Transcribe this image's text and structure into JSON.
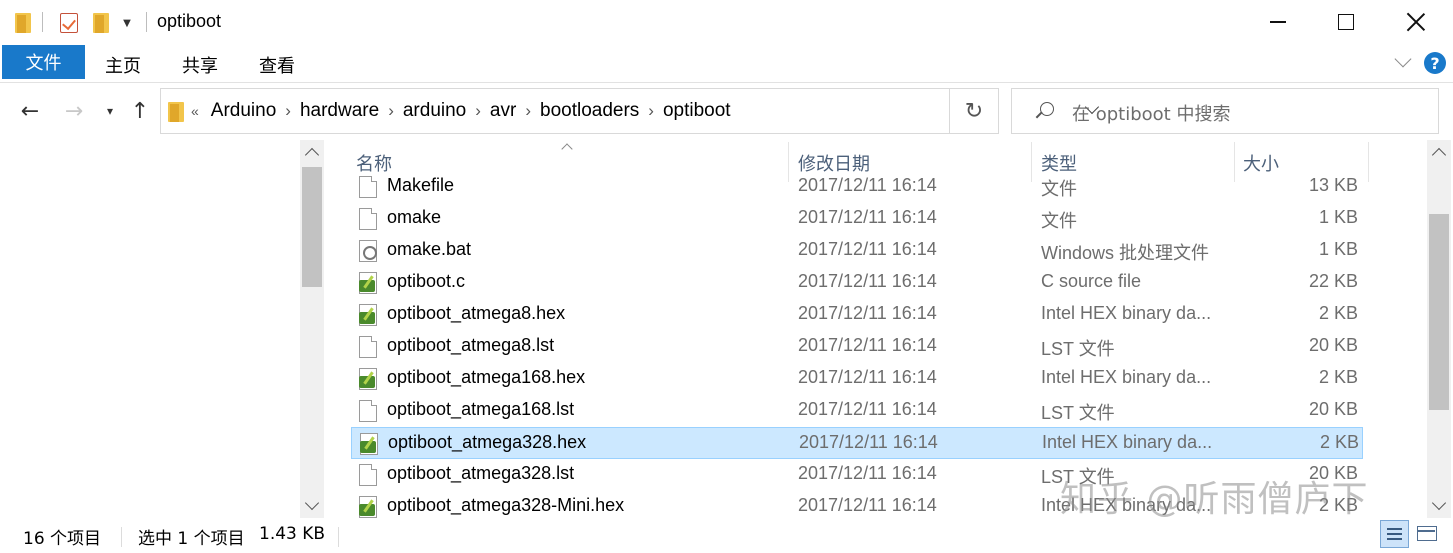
{
  "window": {
    "title": "optiboot"
  },
  "ribbon": {
    "tabs": [
      {
        "label": "文件"
      },
      {
        "label": "主页"
      },
      {
        "label": "共享"
      },
      {
        "label": "查看"
      }
    ],
    "help_label": "?"
  },
  "address": {
    "overflow": "«",
    "crumbs": [
      "Arduino",
      "hardware",
      "arduino",
      "avr",
      "bootloaders",
      "optiboot"
    ],
    "separator": "›"
  },
  "search": {
    "placeholder": "在 optiboot 中搜索"
  },
  "list": {
    "columns": {
      "name": "名称",
      "date": "修改日期",
      "type": "类型",
      "size": "大小"
    },
    "rows": [
      {
        "name": "Makefile",
        "date": "2017/12/11 16:14",
        "type": "文件",
        "size": "13 KB",
        "icon": "document-icon"
      },
      {
        "name": "omake",
        "date": "2017/12/11 16:14",
        "type": "文件",
        "size": "1 KB",
        "icon": "document-icon"
      },
      {
        "name": "omake.bat",
        "date": "2017/12/11 16:14",
        "type": "Windows 批处理文件",
        "size": "1 KB",
        "icon": "batch-file-icon"
      },
      {
        "name": "optiboot.c",
        "date": "2017/12/11 16:14",
        "type": "C source file",
        "size": "22 KB",
        "icon": "notepadpp-file-icon"
      },
      {
        "name": "optiboot_atmega8.hex",
        "date": "2017/12/11 16:14",
        "type": "Intel HEX binary da...",
        "size": "2 KB",
        "icon": "notepadpp-file-icon"
      },
      {
        "name": "optiboot_atmega8.lst",
        "date": "2017/12/11 16:14",
        "type": "LST 文件",
        "size": "20 KB",
        "icon": "document-icon"
      },
      {
        "name": "optiboot_atmega168.hex",
        "date": "2017/12/11 16:14",
        "type": "Intel HEX binary da...",
        "size": "2 KB",
        "icon": "notepadpp-file-icon"
      },
      {
        "name": "optiboot_atmega168.lst",
        "date": "2017/12/11 16:14",
        "type": "LST 文件",
        "size": "20 KB",
        "icon": "document-icon"
      },
      {
        "name": "optiboot_atmega328.hex",
        "date": "2017/12/11 16:14",
        "type": "Intel HEX binary da...",
        "size": "2 KB",
        "icon": "notepadpp-file-icon",
        "selected": true
      },
      {
        "name": "optiboot_atmega328.lst",
        "date": "2017/12/11 16:14",
        "type": "LST 文件",
        "size": "20 KB",
        "icon": "document-icon"
      },
      {
        "name": "optiboot_atmega328-Mini.hex",
        "date": "2017/12/11 16:14",
        "type": "Intel HEX binary da...",
        "size": "2 KB",
        "icon": "notepadpp-file-icon"
      }
    ]
  },
  "status": {
    "item_count": "16 个项目",
    "selection": "选中 1 个项目",
    "selection_size": "1.43 KB"
  },
  "watermark": "知乎 @听雨僧庐下",
  "colors": {
    "accent": "#1979ca",
    "selected_row": "#cce8ff",
    "header_text": "#4c607a"
  }
}
